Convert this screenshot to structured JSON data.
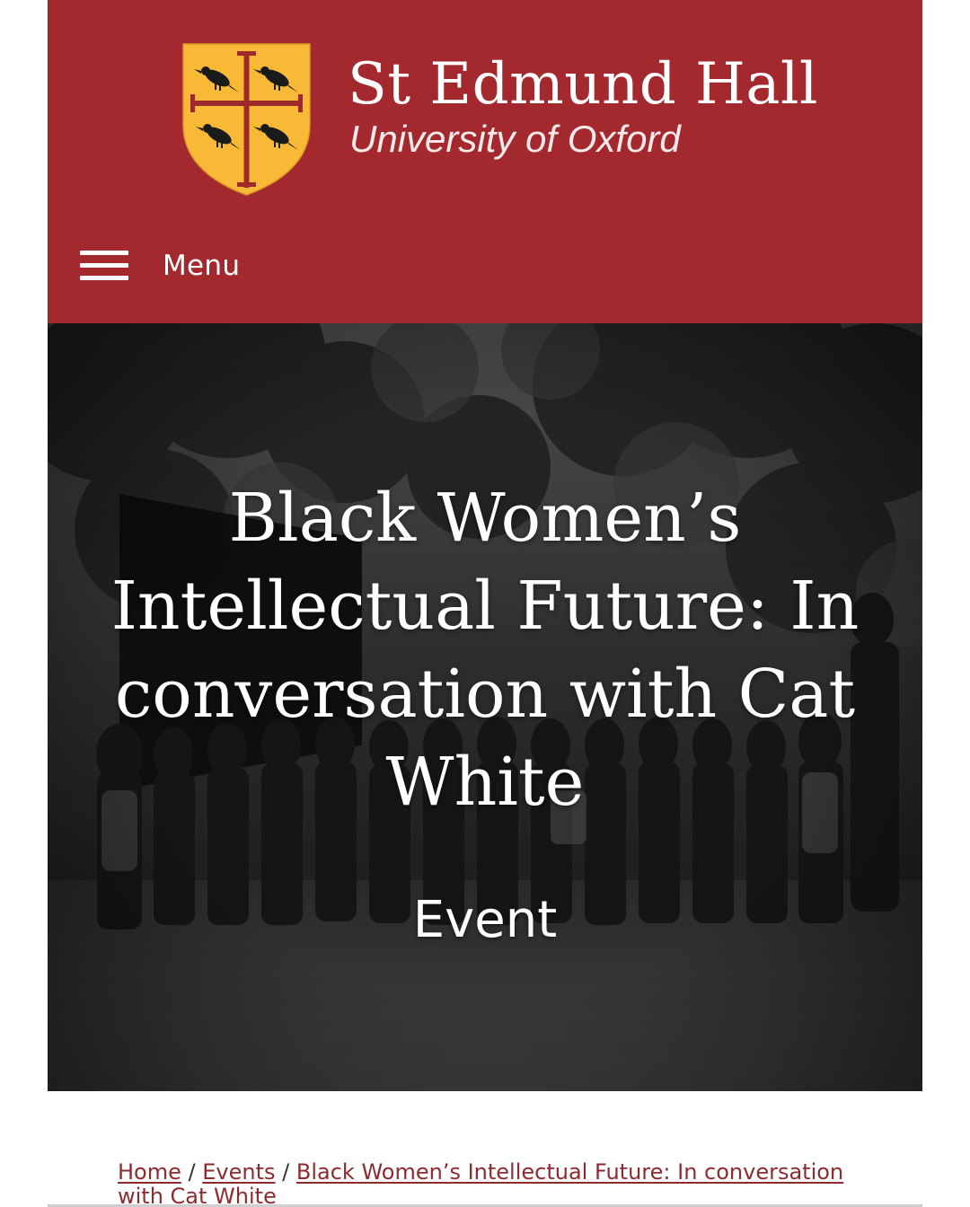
{
  "theme": {
    "brand_color": "#a4292f",
    "shield_color": "#f8b936",
    "cross_color": "#9e2a2b",
    "link_color": "#8e2a30"
  },
  "header": {
    "logo_icon": "college-crest-icon",
    "college_name": "St Edmund Hall",
    "university_name": "University of Oxford",
    "menu_label": "Menu",
    "menu_icon": "hamburger-icon"
  },
  "hero": {
    "title": "Black Women’s Intellectual Future: In conversation with Cat White",
    "type_label": "Event"
  },
  "breadcrumb": {
    "items": [
      "Home",
      "Events",
      "Black Women’s Intellectual Future: In conversation with Cat White"
    ],
    "separator": "/"
  }
}
